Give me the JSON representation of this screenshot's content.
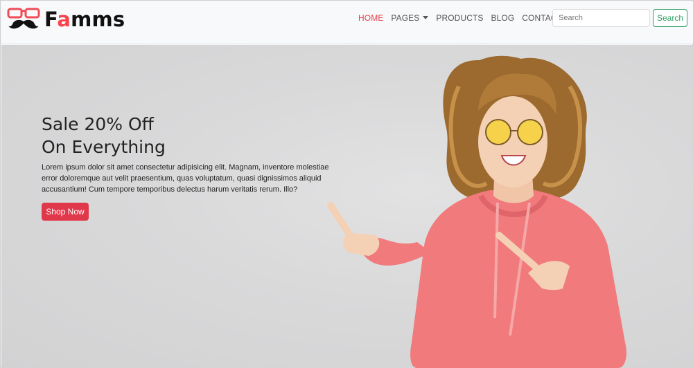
{
  "brand": {
    "name_prefix": "F",
    "name_accent": "a",
    "name_suffix": "mms",
    "accent_color": "#f7444e"
  },
  "nav": {
    "items": [
      {
        "label": "HOME",
        "active": true
      },
      {
        "label": "PAGES",
        "dropdown": true
      },
      {
        "label": "PRODUCTS"
      },
      {
        "label": "BLOG"
      },
      {
        "label": "CONTACT"
      }
    ],
    "cart_icon": "shopping-cart-icon"
  },
  "search": {
    "placeholder": "Search",
    "value": "",
    "button_label": "Search",
    "button_color": "#2e9e63"
  },
  "hero": {
    "title_line1": "Sale 20% Off",
    "title_line2": "On Everything",
    "text": "Lorem ipsum dolor sit amet consectetur adipisicing elit. Magnam, inventore molestiae error doloremque aut velit praesentium, quas voluptatum, quasi dignissimos aliquid accusantium! Cum tempore temporibus delectus harum veritatis rerum. Illo?",
    "cta_label": "Shop Now",
    "cta_color": "#e0374a",
    "image": "woman-pink-hoodie-pointing"
  }
}
